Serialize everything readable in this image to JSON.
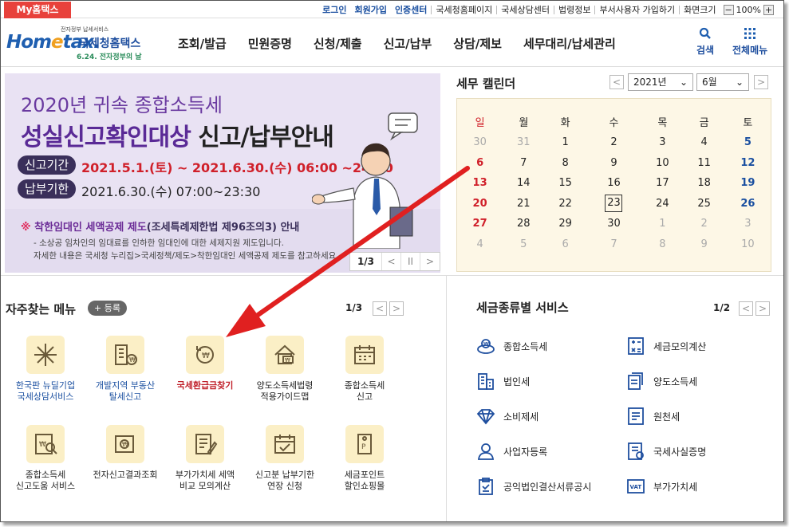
{
  "topbar": {
    "my_tab": "My홈택스",
    "links": [
      "로그인",
      "회원가입",
      "인증센터",
      "국세청홈페이지",
      "국세상담센터",
      "법령정보",
      "부서사용자 가입하기",
      "화면크기"
    ],
    "zoom_minus": "−",
    "zoom_value": "100%",
    "zoom_plus": "+"
  },
  "header": {
    "logo_small": "전자정부 납세서비스",
    "logo_main": "Hom",
    "logo_e": "e",
    "logo_tax": "tax.",
    "logo_name": "국세청홈택스",
    "logo_event": "6.24. 전자정부의 날",
    "nav": [
      "조회/발급",
      "민원증명",
      "신청/제출",
      "신고/납부",
      "상담/제보",
      "세무대리/납세관리"
    ],
    "search_label": "검색",
    "menu_label": "전체메뉴"
  },
  "banner": {
    "title1": "2020년 귀속 종합소득세",
    "title2a": "성실신고확인대상",
    "title2b": " 신고/납부안내",
    "period_label": "신고기간",
    "period_value": "2021.5.1.(토) ~ 2021.6.30.(수) 06:00 ~24:00",
    "due_label": "납부기한",
    "due_value": "2021.6.30.(수) 07:00~23:30",
    "note_mark": "※",
    "note_title": " 착한임대인 세액공제 제도",
    "note_title2": "(조세특례제한법 제96조의3) 안내",
    "note_line1": "- 소상공 임차인의 임대료를 인하한 임대인에 대한 세제지원 제도입니다.",
    "note_line2": "자세한 내용은 국세청 누리집>국세정책/제도>착한임대인 세액공제 제도를 참고하세요",
    "pager": "1/3",
    "prev": "<",
    "pause": "II",
    "next": ">"
  },
  "calendar": {
    "title": "세무 캘린더",
    "year": "2021년",
    "month": "6월",
    "prev": "<",
    "next": ">",
    "weekdays": [
      "일",
      "월",
      "화",
      "수",
      "목",
      "금",
      "토"
    ],
    "weeks": [
      [
        "30",
        "31",
        "1",
        "2",
        "3",
        "4",
        "5"
      ],
      [
        "6",
        "7",
        "8",
        "9",
        "10",
        "11",
        "12"
      ],
      [
        "13",
        "14",
        "15",
        "16",
        "17",
        "18",
        "19"
      ],
      [
        "20",
        "21",
        "22",
        "23",
        "24",
        "25",
        "26"
      ],
      [
        "27",
        "28",
        "29",
        "30",
        "1",
        "2",
        "3"
      ],
      [
        "4",
        "5",
        "6",
        "7",
        "8",
        "9",
        "10"
      ]
    ]
  },
  "quick_menu": {
    "title": "자주찾는 메뉴",
    "add_label": "+ 등록",
    "pager": "1/3",
    "prev": "<",
    "next": ">",
    "items": [
      {
        "line1": "한국판 뉴딜기업",
        "line2": "국세상담서비스",
        "icon": "sparkle-icon"
      },
      {
        "line1": "개발지역 부동산",
        "line2": "탈세신고",
        "icon": "building-money-icon"
      },
      {
        "line1": "국세환급금찾기",
        "line2": "",
        "icon": "refund-coin-icon"
      },
      {
        "line1": "양도소득세법령",
        "line2": "적용가이드맵",
        "icon": "house-money-icon"
      },
      {
        "line1": "종합소득세",
        "line2": "신고",
        "icon": "calendar-icon"
      },
      {
        "line1": "종합소득세",
        "line2": "신고도움 서비스",
        "icon": "document-search-icon"
      },
      {
        "line1": "전자신고결과조회",
        "line2": "",
        "icon": "money-search-icon"
      },
      {
        "line1": "부가가치세 세액",
        "line2": "비교 모의계산",
        "icon": "document-edit-icon"
      },
      {
        "line1": "신고분 납부기한",
        "line2": "연장 신청",
        "icon": "calendar-check-icon"
      },
      {
        "line1": "세금포인트",
        "line2": "할인쇼핑몰",
        "icon": "point-tag-icon"
      }
    ]
  },
  "tax_services": {
    "title": "세금종류별 서비스",
    "pager": "1/2",
    "prev": "<",
    "next": ">",
    "items": [
      {
        "label": "종합소득세",
        "icon": "coins-icon"
      },
      {
        "label": "세금모의계산",
        "icon": "calculator-icon"
      },
      {
        "label": "법인세",
        "icon": "company-icon"
      },
      {
        "label": "양도소득세",
        "icon": "transfer-document-icon"
      },
      {
        "label": "소비제세",
        "icon": "diamond-icon"
      },
      {
        "label": "원천세",
        "icon": "receipt-icon"
      },
      {
        "label": "사업자등록",
        "icon": "person-icon"
      },
      {
        "label": "국세사실증명",
        "icon": "certificate-icon"
      },
      {
        "label": "공익법인결산서류공시",
        "icon": "clipboard-icon"
      },
      {
        "label": "부가가치세",
        "icon": "vat-icon"
      }
    ]
  },
  "colors": {
    "accent": "#1a4fa0",
    "brand_red": "#e8413b",
    "annotation_arrow": "#e02020"
  }
}
